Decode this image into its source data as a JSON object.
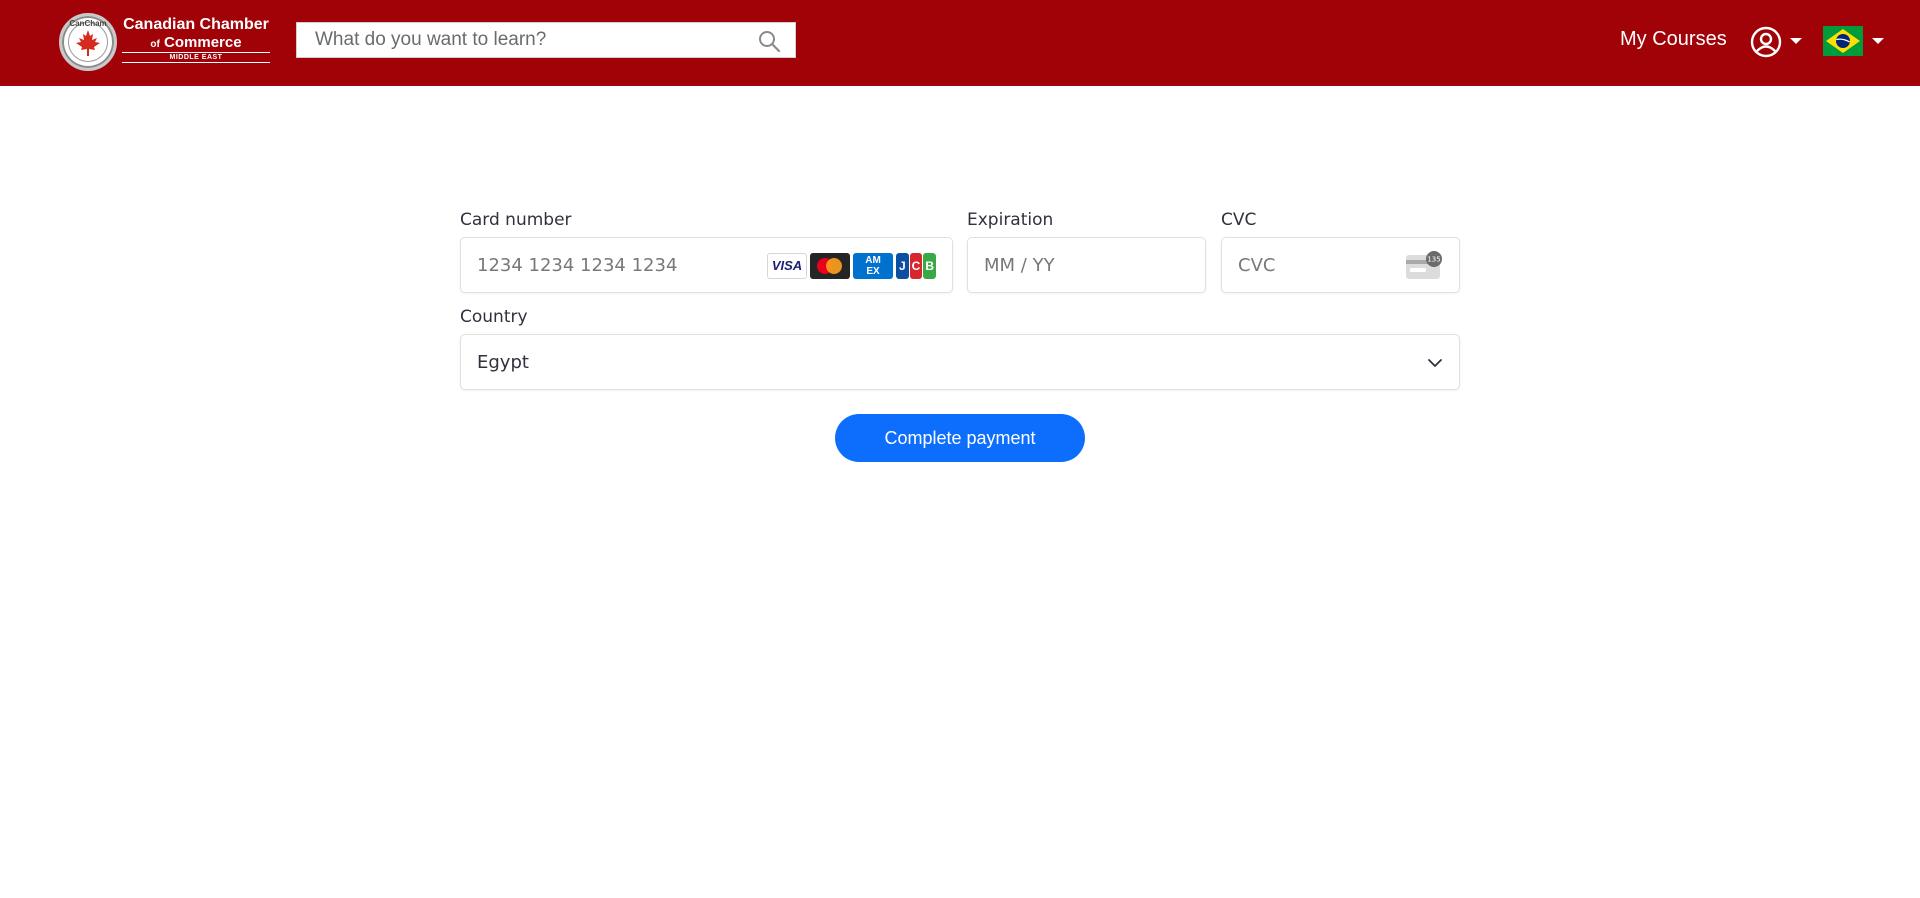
{
  "header": {
    "logo": {
      "seal_text": "CanCham",
      "line1": "Canadian Chamber",
      "line2_prefix": "of",
      "line2": "Commerce",
      "line3": "MIDDLE EAST"
    },
    "search": {
      "placeholder": "What do you want to learn?",
      "value": "",
      "icon": "search-icon"
    },
    "nav": {
      "my_courses": "My Courses"
    },
    "user_menu": {
      "icon": "user-circle-icon"
    },
    "language_menu": {
      "icon": "brazil-flag-icon"
    },
    "colors": {
      "background": "#a00208",
      "text": "#ffffff"
    }
  },
  "payment_form": {
    "card_number": {
      "label": "Card number",
      "placeholder": "1234 1234 1234 1234",
      "value": "",
      "brands": [
        "visa",
        "mastercard",
        "amex",
        "jcb"
      ],
      "visa_text": "VISA",
      "amex_line1": "AM",
      "amex_line2": "EX",
      "jcb_letters": [
        "J",
        "C",
        "B"
      ]
    },
    "expiration": {
      "label": "Expiration",
      "placeholder": "MM / YY",
      "value": ""
    },
    "cvc": {
      "label": "CVC",
      "placeholder": "CVC",
      "value": "",
      "icon": "cvc-card-icon",
      "icon_text": "135"
    },
    "country": {
      "label": "Country",
      "selected": "Egypt",
      "icon": "chevron-down-icon"
    },
    "submit": {
      "label": "Complete payment",
      "color": "#0d6efd"
    }
  }
}
